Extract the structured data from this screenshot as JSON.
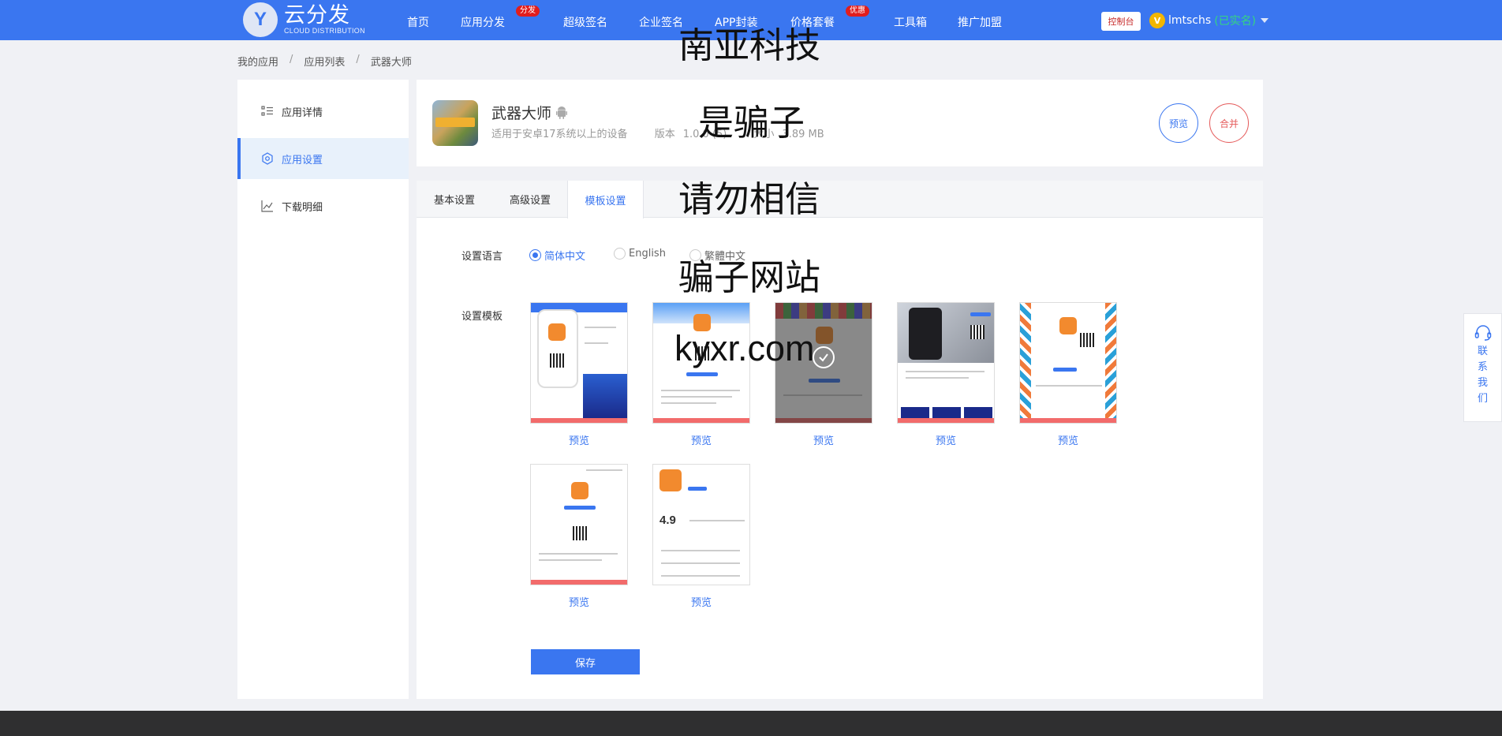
{
  "header": {
    "logo_letter": "Y",
    "logo_main": "云分发",
    "logo_sub": "CLOUD DISTRIBUTION",
    "nav": [
      {
        "label": "首页"
      },
      {
        "label": "应用分发",
        "badge": "分发"
      },
      {
        "label": "超级签名"
      },
      {
        "label": "企业签名"
      },
      {
        "label": "APP封装"
      },
      {
        "label": "价格套餐",
        "badge": "优惠"
      },
      {
        "label": "工具箱"
      },
      {
        "label": "推广加盟"
      }
    ],
    "console_label": "控制台",
    "user_badge": "V",
    "username": "lmtschs",
    "verified": "(已实名)"
  },
  "breadcrumb": [
    "我的应用",
    "应用列表",
    "武器大师"
  ],
  "sidebar": {
    "items": [
      {
        "label": "应用详情",
        "icon": "list-icon"
      },
      {
        "label": "应用设置",
        "icon": "gear-icon",
        "active": true
      },
      {
        "label": "下载明细",
        "icon": "chart-icon"
      }
    ]
  },
  "app": {
    "name": "武器大师",
    "platform_icon": "android-icon",
    "compat": "适用于安卓17系统以上的设备",
    "version_label": "版本",
    "version_value": "1.0.0 (5)",
    "size_label": "大小",
    "size_value": "3.89 MB",
    "preview_label": "预览",
    "merge_label": "合并"
  },
  "tabs": [
    {
      "label": "基本设置"
    },
    {
      "label": "高级设置"
    },
    {
      "label": "模板设置",
      "active": true
    }
  ],
  "language": {
    "label": "设置语言",
    "options": [
      {
        "label": "简体中文",
        "checked": true
      },
      {
        "label": "English",
        "checked": false
      },
      {
        "label": "繁體中文",
        "checked": false
      }
    ]
  },
  "template": {
    "label": "设置模板",
    "preview_label": "预览",
    "selected_index": 2,
    "count": 7
  },
  "save_label": "保存",
  "watermark": [
    "南亚科技",
    "是骗子",
    "请勿相信",
    "骗子网站",
    "kyxr.com"
  ],
  "contact_label": "联系我们",
  "colors": {
    "primary": "#3a76f0",
    "danger": "#e55a5a",
    "badge": "#e11d1d",
    "verified": "#34d680"
  }
}
